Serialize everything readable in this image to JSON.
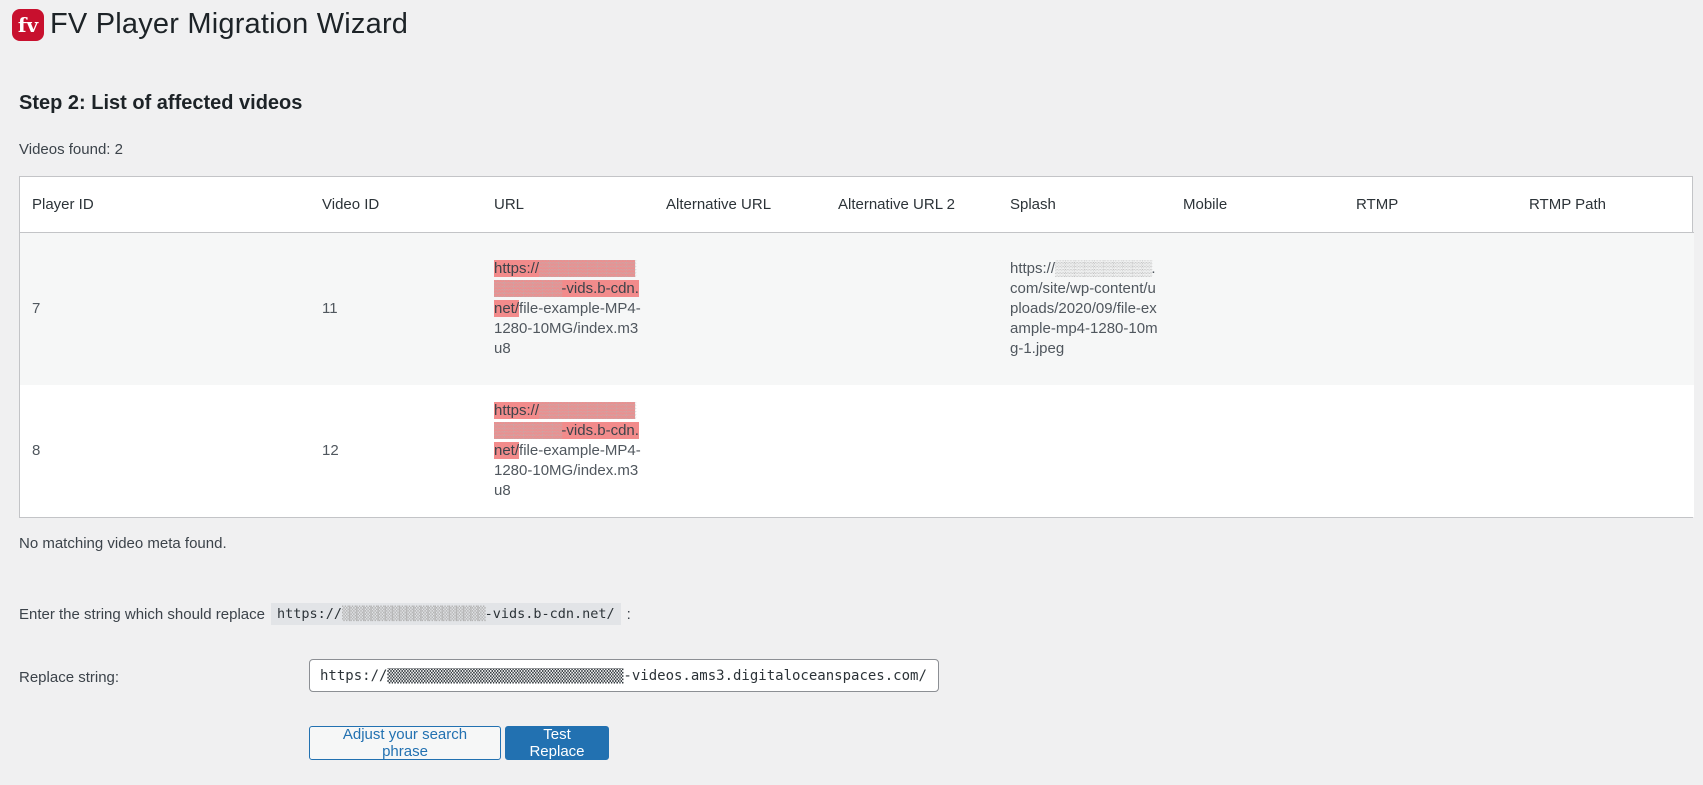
{
  "header": {
    "logo_text": "fv",
    "title": "FV Player Migration Wizard"
  },
  "step": {
    "title": "Step 2: List of affected videos",
    "videos_found": "Videos found: 2"
  },
  "table": {
    "columns": [
      "Player ID",
      "Video ID",
      "URL",
      "Alternative URL",
      "Alternative URL 2",
      "Splash",
      "Mobile",
      "RTMP",
      "RTMP Path"
    ],
    "rows": [
      {
        "player_id": "7",
        "video_id": "11",
        "url_prefix_a": "https://",
        "url_prefix_blur": "▒▒▒▒▒▒▒▒▒▒▒▒▒▒▒▒▒",
        "url_prefix_b": "-vids.b-cdn.net/",
        "url_suffix": "file-example-MP4-1280-10MG/index.m3u8",
        "alt_url": "",
        "alt_url_2": "",
        "splash_a": "https://",
        "splash_blur": "▒▒▒▒▒▒▒▒▒▒",
        "splash_b": ".com/site/wp-content/uploads/2020/09/file-example-mp4-1280-10mg-1.jpeg",
        "mobile": "",
        "rtmp": "",
        "rtmp_path": ""
      },
      {
        "player_id": "8",
        "video_id": "12",
        "url_prefix_a": "https://",
        "url_prefix_blur": "▒▒▒▒▒▒▒▒▒▒▒▒▒▒▒▒▒",
        "url_prefix_b": "-vids.b-cdn.net/",
        "url_suffix": "file-example-MP4-1280-10MG/index.m3u8",
        "alt_url": "",
        "alt_url_2": "",
        "splash_a": "",
        "splash_blur": "",
        "splash_b": "",
        "mobile": "",
        "rtmp": "",
        "rtmp_path": ""
      }
    ]
  },
  "meta_status": "No matching video meta found.",
  "replace": {
    "label": "Enter the string which should replace",
    "search_code_a": "https://",
    "search_code_blur": "▒▒▒▒▒▒▒▒▒▒▒▒▒▒▒▒▒▒▒▒",
    "search_code_b": "-vids.b-cdn.net/",
    "colon": ":",
    "replace_string_label": "Replace string:",
    "replace_value": "https://▒▒▒▒▒▒▒▒▒▒▒▒▒▒▒▒▒▒▒▒▒▒▒▒▒▒▒▒-videos.ams3.digitaloceanspaces.com/"
  },
  "buttons": {
    "adjust_label": "Adjust your search phrase",
    "test_label": "Test Replace"
  },
  "colors": {
    "logo": "#c8102e",
    "highlight": "#f28b8b",
    "primary": "#2271b1",
    "background": "#f0f0f1"
  }
}
